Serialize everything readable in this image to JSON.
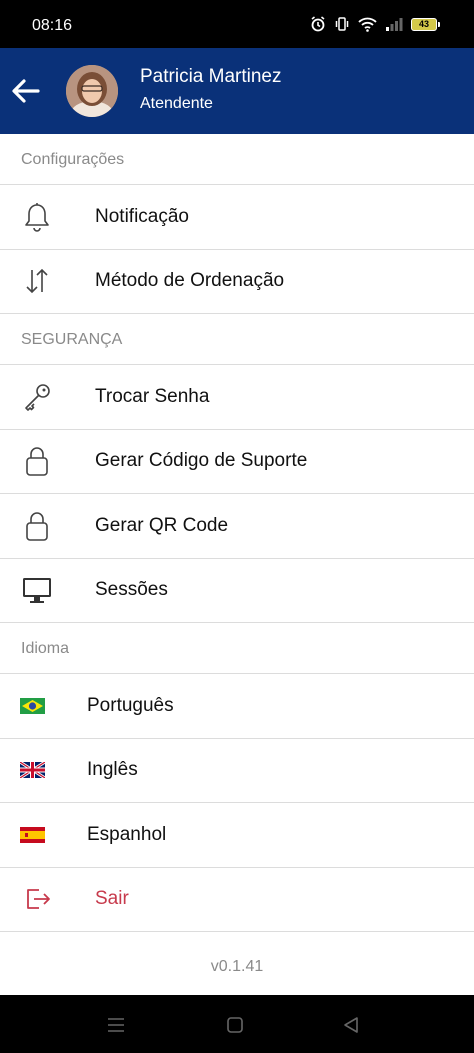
{
  "status_bar": {
    "time": "08:16",
    "battery": "43"
  },
  "header": {
    "user_name": "Patricia Martinez",
    "user_role": "Atendente"
  },
  "sections": {
    "config": {
      "title": "Configurações",
      "items": [
        {
          "label": "Notificação",
          "icon": "bell-icon"
        },
        {
          "label": "Método de Ordenação",
          "icon": "sort-arrows-icon"
        }
      ]
    },
    "security": {
      "title": "SEGURANÇA",
      "items": [
        {
          "label": "Trocar Senha",
          "icon": "key-icon"
        },
        {
          "label": "Gerar Código de Suporte",
          "icon": "lock-icon"
        },
        {
          "label": "Gerar QR Code",
          "icon": "lock-icon"
        },
        {
          "label": "Sessões",
          "icon": "monitor-icon"
        }
      ]
    },
    "language": {
      "title": "Idioma",
      "items": [
        {
          "label": "Português",
          "icon": "brazil-flag-icon"
        },
        {
          "label": "Inglês",
          "icon": "uk-flag-icon"
        },
        {
          "label": "Espanhol",
          "icon": "spain-flag-icon"
        }
      ]
    }
  },
  "logout": {
    "label": "Sair",
    "icon": "logout-icon",
    "color": "#c73a4c"
  },
  "version": "v0.1.41",
  "colors": {
    "header_bg": "#0a3179",
    "divider": "#dcdcdc",
    "section_text": "#8a8a8a"
  }
}
